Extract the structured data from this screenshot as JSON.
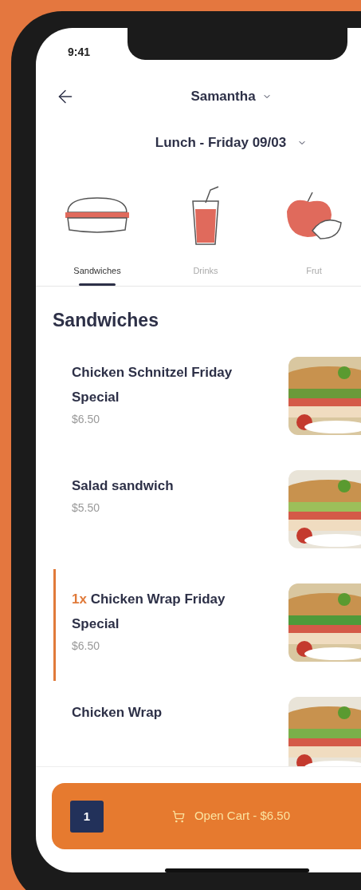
{
  "status_bar": {
    "time": "9:41"
  },
  "header": {
    "child": "Samantha",
    "meal": "Lunch - Friday 09/03"
  },
  "categories": [
    {
      "kind": "sandwich",
      "label": "Sandwiches",
      "selected": true
    },
    {
      "kind": "drink",
      "label": "Drinks",
      "selected": false
    },
    {
      "kind": "fruit",
      "label": "Frut",
      "selected": false
    }
  ],
  "section_title": "Sandwiches",
  "items": [
    {
      "name": "Chicken Schnitzel Friday Special",
      "price": "$6.50",
      "in_cart": false
    },
    {
      "name": "Salad sandwich",
      "price": "$5.50",
      "in_cart": false
    },
    {
      "quantity": "1x",
      "name": "Chicken Wrap Friday Special",
      "price": "$6.50",
      "in_cart": true
    },
    {
      "name": "Chicken Wrap",
      "in_cart": false
    }
  ],
  "cart": {
    "count": "1",
    "label": "Open Cart - $6.50"
  }
}
